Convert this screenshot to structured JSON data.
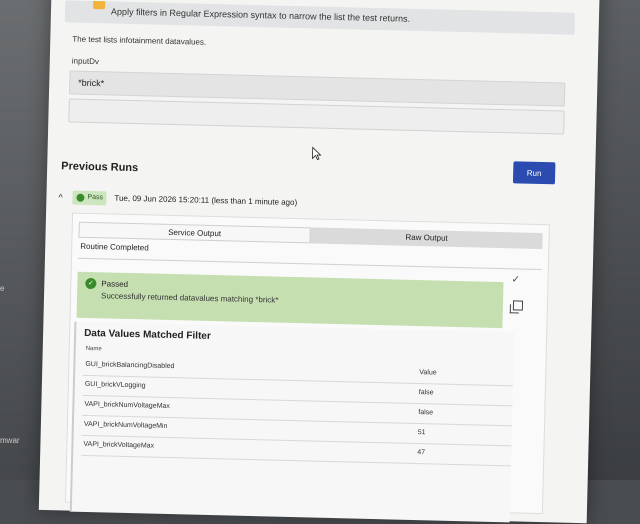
{
  "background": {
    "left_ghost_text": "e",
    "left_ghost_text2": "mwar"
  },
  "banner": {
    "text": "Apply filters in Regular Expression syntax to narrow the list the test returns.",
    "icon": "warning-icon"
  },
  "form": {
    "description": "The test lists infotainment datavalues.",
    "input_label": "inputDv",
    "input_value": "*brick*"
  },
  "previous_runs": {
    "title": "Previous Runs",
    "run_button_label": "Run",
    "run": {
      "status": "Pass",
      "timestamp": "Tue, 09 Jun 2026 15:20:11 (less than 1 minute ago)",
      "tabs": [
        {
          "label": "Service Output",
          "active": true
        },
        {
          "label": "Raw Output",
          "active": false
        }
      ],
      "routine_text": "Routine Completed",
      "result_title": "Passed",
      "result_message": "Successfully returned datavalues matching *brick*",
      "data_values": {
        "title": "Data Values Matched Filter",
        "columns": [
          "Name",
          "Value"
        ],
        "rows": [
          {
            "name": "GUI_brickBalancingDisabled",
            "value": ""
          },
          {
            "name": "GUI_brickVLogging",
            "value": "false"
          },
          {
            "name": "VAPI_brickNumVoltageMax",
            "value": "false"
          },
          {
            "name": "VAPI_brickNumVoltageMin",
            "value": "51"
          },
          {
            "name": "VAPI_brickVoltageMax",
            "value": "47"
          }
        ]
      }
    }
  },
  "colors": {
    "accent": "#2b4bb0",
    "pass_green": "#3a8b2a",
    "passed_bg": "#c5dfb1",
    "warning": "#f2b33d"
  }
}
